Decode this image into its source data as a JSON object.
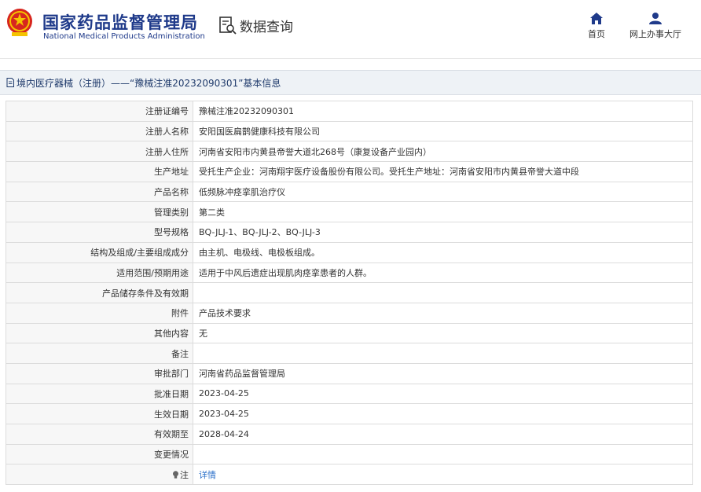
{
  "header": {
    "title_cn": "国家药品监督管理局",
    "title_en": "National Medical Products Administration",
    "query_label": "数据查询",
    "nav": [
      {
        "label": "首页",
        "icon": "home-icon"
      },
      {
        "label": "网上办事大厅",
        "icon": "user-icon"
      }
    ]
  },
  "breadcrumb": {
    "text": "境内医疗器械（注册）——“豫械注准20232090301”基本信息",
    "icon": "document-icon"
  },
  "details": {
    "rows": [
      {
        "label": "注册证编号",
        "value": "豫械注准20232090301"
      },
      {
        "label": "注册人名称",
        "value": "安阳国医扁鹊健康科技有限公司"
      },
      {
        "label": "注册人住所",
        "value": "河南省安阳市内黄县帝誉大道北268号（康复设备产业园内）"
      },
      {
        "label": "生产地址",
        "value": "受托生产企业：河南翔宇医疗设备股份有限公司。受托生产地址：河南省安阳市内黄县帝誉大道中段"
      },
      {
        "label": "产品名称",
        "value": "低频脉冲痉挛肌治疗仪"
      },
      {
        "label": "管理类别",
        "value": "第二类"
      },
      {
        "label": "型号规格",
        "value": "BQ-JLJ-1、BQ-JLJ-2、BQ-JLJ-3"
      },
      {
        "label": "结构及组成/主要组成成分",
        "value": "由主机、电极线、电极板组成。"
      },
      {
        "label": "适用范围/预期用途",
        "value": "适用于中风后遗症出现肌肉痉挛患者的人群。"
      },
      {
        "label": "产品储存条件及有效期",
        "value": ""
      },
      {
        "label": "附件",
        "value": "产品技术要求"
      },
      {
        "label": "其他内容",
        "value": "无"
      },
      {
        "label": "备注",
        "value": ""
      },
      {
        "label": "审批部门",
        "value": "河南省药品监督管理局"
      },
      {
        "label": "批准日期",
        "value": "2023-04-25"
      },
      {
        "label": "生效日期",
        "value": "2023-04-25"
      },
      {
        "label": "有效期至",
        "value": "2028-04-24"
      },
      {
        "label": "变更情况",
        "value": ""
      }
    ],
    "note": {
      "label": "注",
      "link": "详情",
      "icon": "lightbulb-icon"
    }
  },
  "colors": {
    "brand_blue": "#1f3a8a",
    "link_blue": "#2a6fc9",
    "crumb_bg": "#eef2f6"
  }
}
